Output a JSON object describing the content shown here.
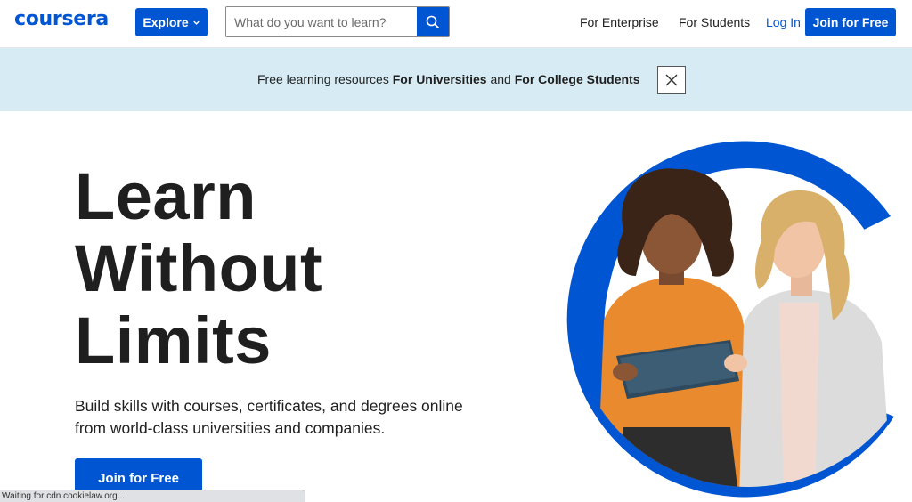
{
  "header": {
    "logo": "coursera",
    "explore_label": "Explore",
    "search_placeholder": "What do you want to learn?",
    "nav": {
      "enterprise": "For Enterprise",
      "students": "For Students",
      "login": "Log In",
      "join": "Join for Free"
    }
  },
  "banner": {
    "text_prefix": "Free learning resources",
    "link_universities": "For Universities",
    "text_and": "and",
    "link_students": "For College Students"
  },
  "hero": {
    "title_lines": [
      "Learn",
      "Without",
      "Limits"
    ],
    "subtitle_line1": "Build skills with courses, certificates, and degrees online",
    "subtitle_line2": "from world-class universities and companies.",
    "cta": "Join for Free"
  },
  "status_bar": {
    "text": "Waiting for cdn.cookielaw.org..."
  },
  "colors": {
    "brand_blue": "#0056d2",
    "banner_bg": "#d6ebf3",
    "text": "#1f1f1f"
  },
  "icons": {
    "explore_chevron": "chevron-down-icon",
    "search": "search-icon",
    "close": "close-icon"
  }
}
